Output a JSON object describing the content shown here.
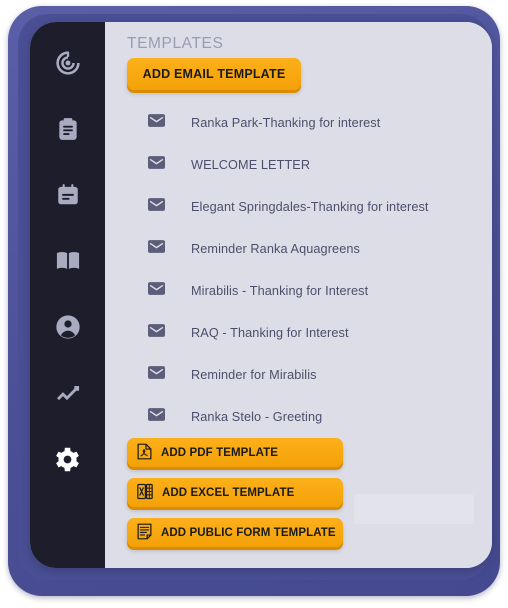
{
  "theme": {
    "frame_blue": "#4f54a0",
    "rail_dark": "#1d1d2b",
    "panel_gray": "#dcdde6",
    "accent_orange": "#f7a80b",
    "text_dark": "#4c4f6b",
    "title_gray": "#9a9cb2",
    "icon_inactive": "#a9abc0",
    "icon_active": "#ffffff"
  },
  "sidebar": {
    "items": [
      {
        "name": "radar-target-icon",
        "label": "Dashboard",
        "active": false
      },
      {
        "name": "clipboard-icon",
        "label": "Tasks",
        "active": false
      },
      {
        "name": "calendar-icon",
        "label": "Calendar",
        "active": false
      },
      {
        "name": "book-icon",
        "label": "Directory",
        "active": false
      },
      {
        "name": "user-circle-icon",
        "label": "Contacts",
        "active": false
      },
      {
        "name": "trending-up-icon",
        "label": "Reports",
        "active": false
      },
      {
        "name": "gear-icon",
        "label": "Settings",
        "active": true
      }
    ]
  },
  "main": {
    "section_title": "TEMPLATES",
    "add_email_label": "ADD EMAIL TEMPLATE",
    "templates": [
      {
        "icon": "envelope-icon",
        "label": "Ranka Park-Thanking for interest"
      },
      {
        "icon": "envelope-icon",
        "label": "WELCOME LETTER"
      },
      {
        "icon": "envelope-icon",
        "label": "Elegant Springdales-Thanking for interest"
      },
      {
        "icon": "envelope-icon",
        "label": "Reminder Ranka Aquagreens"
      },
      {
        "icon": "envelope-icon",
        "label": "Mirabilis - Thanking for Interest"
      },
      {
        "icon": "envelope-icon",
        "label": "RAQ - Thanking for Interest"
      },
      {
        "icon": "envelope-icon",
        "label": "Reminder for Mirabilis"
      },
      {
        "icon": "envelope-icon",
        "label": "Ranka Stelo - Greeting"
      }
    ],
    "bottom_buttons": [
      {
        "icon": "pdf-file-icon",
        "label": "ADD PDF TEMPLATE"
      },
      {
        "icon": "excel-file-icon",
        "label": "ADD EXCEL TEMPLATE"
      },
      {
        "icon": "form-file-icon",
        "label": "ADD PUBLIC FORM TEMPLATE"
      }
    ]
  }
}
